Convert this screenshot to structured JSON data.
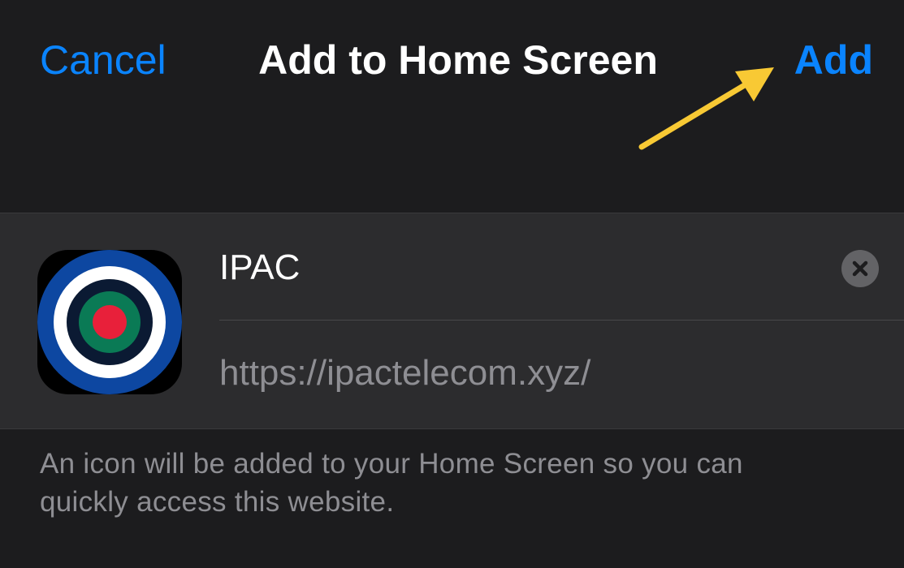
{
  "nav": {
    "cancel_label": "Cancel",
    "title": "Add to Home Screen",
    "add_label": "Add"
  },
  "shortcut": {
    "name_value": "IPAC",
    "url": "https://ipactelecom.xyz/",
    "icon": "target-logo-icon",
    "icon_colors": [
      "#0d47a1",
      "#ffffff",
      "#0b1a33",
      "#0a7a55",
      "#e8203a"
    ]
  },
  "footer": {
    "note": "An icon will be added to your Home Screen so you can quickly access this website."
  },
  "colors": {
    "accent": "#0a84ff",
    "annotation_arrow": "#f8c934",
    "background": "#1c1c1e",
    "card": "#2c2c2e"
  }
}
